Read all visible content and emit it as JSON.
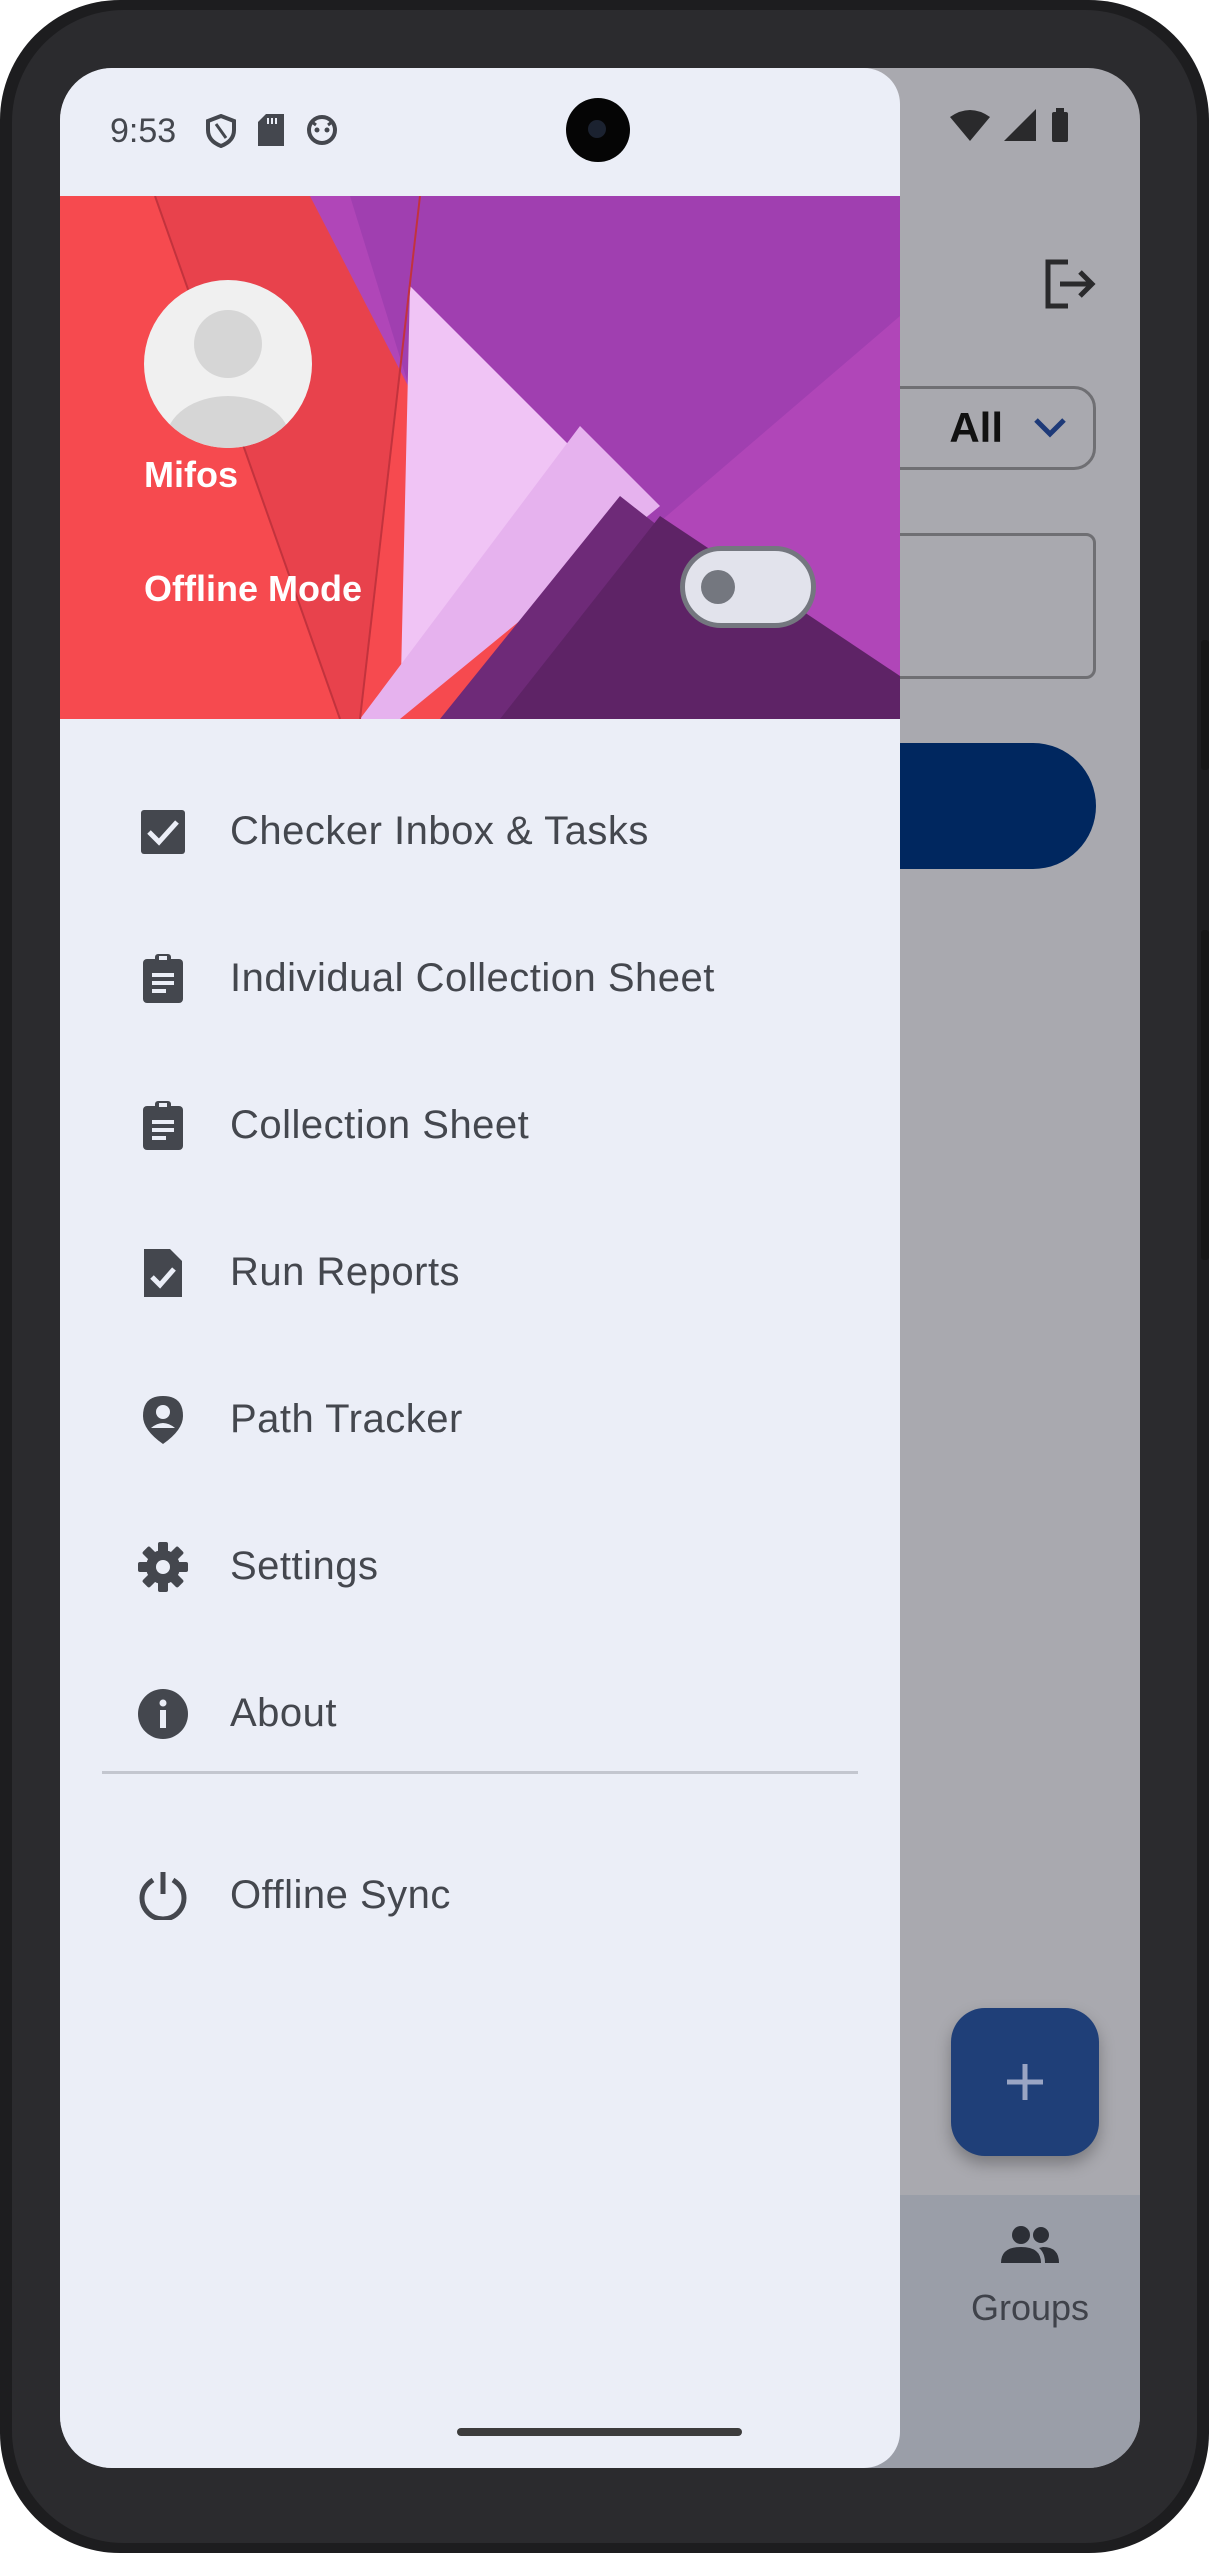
{
  "status_bar": {
    "time": "9:53"
  },
  "drawer": {
    "header": {
      "user_name": "Mifos",
      "offline_mode_label": "Offline Mode",
      "offline_mode_enabled": false
    },
    "menu_items": [
      {
        "label": "Checker Inbox & Tasks",
        "icon": "checkbox-icon"
      },
      {
        "label": "Individual Collection Sheet",
        "icon": "clipboard-icon"
      },
      {
        "label": "Collection Sheet",
        "icon": "clipboard-icon"
      },
      {
        "label": "Run Reports",
        "icon": "file-check-icon"
      },
      {
        "label": "Path Tracker",
        "icon": "person-pin-icon"
      },
      {
        "label": "Settings",
        "icon": "gear-icon"
      },
      {
        "label": "About",
        "icon": "info-icon"
      }
    ],
    "footer_item": {
      "label": "Offline Sync",
      "icon": "power-icon"
    }
  },
  "background_app": {
    "filter_dropdown_value": "All",
    "bottom_nav_groups_label": "Groups",
    "fab_icon": "plus-icon"
  },
  "colors": {
    "drawer_bg": "#ebeef7",
    "header_red": "#f64a4f",
    "header_purple": "#a03fb0",
    "primary": "#00275f"
  }
}
